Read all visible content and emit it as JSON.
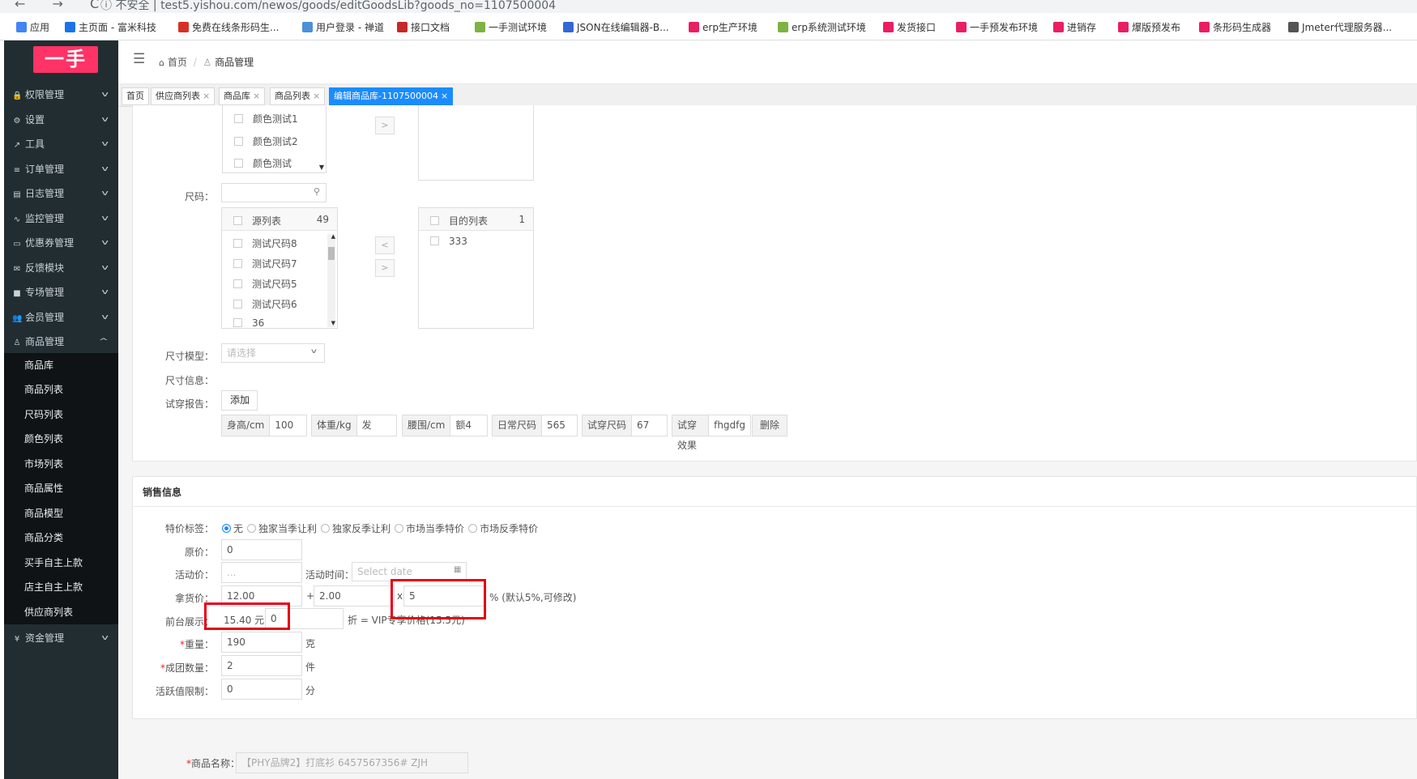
{
  "browser": {
    "nav_glyphs": "← → C",
    "address": "ⓘ 不安全 | test5.yishou.com/newos/goods/editGoodsLib?goods_no=1107500004",
    "bookmarks": [
      {
        "label": "应用",
        "color": "#4285f4"
      },
      {
        "label": "主页面 - 富米科技",
        "color": "#1a73e8"
      },
      {
        "label": "免费在线条形码生...",
        "color": "#d93025"
      },
      {
        "label": "用户登录 - 禅道",
        "color": "#4a90d9"
      },
      {
        "label": "接口文档",
        "color": "#c62828"
      },
      {
        "label": "一手测试环境",
        "color": "#7cb342"
      },
      {
        "label": "JSON在线编辑器-B...",
        "color": "#3367d6"
      },
      {
        "label": "erp生产环境",
        "color": "#e91e63"
      },
      {
        "label": "erp系统测试环境",
        "color": "#7cb342"
      },
      {
        "label": "发货接口",
        "color": "#e91e63"
      },
      {
        "label": "一手预发布环境",
        "color": "#e91e63"
      },
      {
        "label": "进销存",
        "color": "#e91e63"
      },
      {
        "label": "爆版预发布",
        "color": "#e91e63"
      },
      {
        "label": "条形码生成器",
        "color": "#e91e63"
      },
      {
        "label": "Jmeter代理服务器...",
        "color": "#555555"
      }
    ]
  },
  "sidebar": {
    "logo": "一手",
    "menu": [
      {
        "label": "权限管理",
        "icon": "lock-icon",
        "glyph": "🔒"
      },
      {
        "label": "设置",
        "icon": "gear-icon",
        "glyph": "⚙"
      },
      {
        "label": "工具",
        "icon": "wrench-icon",
        "glyph": "↗"
      },
      {
        "label": "订单管理",
        "icon": "list-icon",
        "glyph": "≡"
      },
      {
        "label": "日志管理",
        "icon": "log-icon",
        "glyph": "▤"
      },
      {
        "label": "监控管理",
        "icon": "pulse-icon",
        "glyph": "∿"
      },
      {
        "label": "优惠券管理",
        "icon": "card-icon",
        "glyph": "▭"
      },
      {
        "label": "反馈模块",
        "icon": "mail-icon",
        "glyph": "✉"
      },
      {
        "label": "专场管理",
        "icon": "square-icon",
        "glyph": "■"
      },
      {
        "label": "会员管理",
        "icon": "users-icon",
        "glyph": "👥"
      },
      {
        "label": "商品管理",
        "icon": "shirt-icon",
        "glyph": "♙"
      }
    ],
    "submenu": [
      "商品库",
      "商品列表",
      "尺码列表",
      "颜色列表",
      "市场列表",
      "商品属性",
      "商品模型",
      "商品分类",
      "买手自主上款",
      "店主自主上款",
      "供应商列表"
    ],
    "last_menu": {
      "label": "资金管理",
      "icon": "yen-icon",
      "glyph": "¥"
    }
  },
  "header": {
    "breadcrumb_home": "首页",
    "breadcrumb_sep": "/",
    "breadcrumb_current": "商品管理"
  },
  "tabs": [
    "首页",
    "供应商列表",
    "商品库",
    "商品列表",
    "编辑商品库-1107500004"
  ],
  "attributes": {
    "color_items": [
      "颜色测试1",
      "颜色测试2",
      "颜色测试"
    ],
    "size_label": "尺码：",
    "size_source_header": "源列表",
    "size_source_count": "49",
    "size_items": [
      "测试尺码8",
      "测试尺码7",
      "测试尺码5",
      "测试尺码6",
      "36"
    ],
    "size_target_header": "目的列表",
    "size_target_count": "1",
    "size_target_items": [
      "333"
    ],
    "size_model_label": "尺寸模型：",
    "size_model_placeholder": "请选择",
    "size_info_label": "尺寸信息：",
    "tryon_label": "试穿报告：",
    "add_button": "添加",
    "tryon_fields": [
      {
        "label": "身高/cm",
        "value": "100"
      },
      {
        "label": "体重/kg",
        "value": "发"
      },
      {
        "label": "腰围/cm",
        "value": "额4"
      },
      {
        "label": "日常尺码",
        "value": "565"
      },
      {
        "label": "试穿尺码",
        "value": "67"
      },
      {
        "label": "试穿效果",
        "value": "fhgdfg"
      }
    ],
    "delete_button": "删除"
  },
  "sales": {
    "title": "销售信息",
    "special_label": "特价标签：",
    "special_options": [
      "无",
      "独家当季让利",
      "独家反季让利",
      "市场当季特价",
      "市场反季特价"
    ],
    "special_selected": "无",
    "original_price_label": "原价：",
    "original_price": "0",
    "activity_price_label": "活动价：",
    "activity_price_placeholder": "...",
    "activity_time_label": "活动时间：",
    "activity_time_placeholder": "Select date",
    "cost_label": "拿货价：",
    "cost_value": "12.00",
    "plus": "+",
    "markup_value": "2.00",
    "times": "x",
    "rate_value": "5",
    "rate_note": "% (默认5%,可修改)",
    "front_label": "前台展示：",
    "front_price": "15.40 元 x",
    "discount_value": "0",
    "vip_note": "折 = VIP专享价格(15.5元)",
    "weight_label": "重量：",
    "weight_value": "190",
    "weight_unit": "克",
    "group_label": "成团数量：",
    "group_value": "2",
    "group_unit": "件",
    "active_label": "活跃值限制：",
    "active_value": "0",
    "active_unit": "分",
    "required_mark": "*"
  },
  "product": {
    "name_label": "商品名称：",
    "name_value": "【PHY品牌2】打底衫 6457567356# ZJH"
  },
  "colors": {
    "sidebar_bg": "#222d32",
    "submenu_bg": "#0f1315",
    "logo_bg": "#ff3366",
    "active_tab": "#1a8cff",
    "highlight": "#e60012"
  }
}
